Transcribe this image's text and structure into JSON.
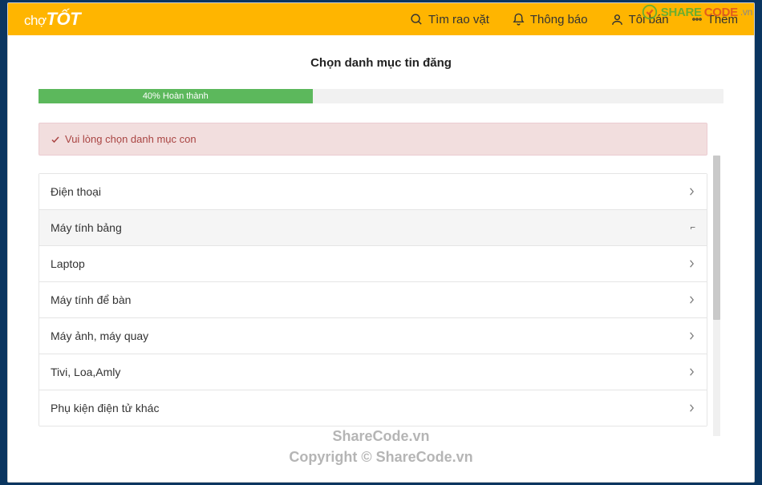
{
  "header": {
    "logo_cho": "chợ",
    "logo_tot": "TỐT",
    "nav": {
      "search": "Tìm rao vặt",
      "notify": "Thông báo",
      "sell": "Tôi bán",
      "more": "Thêm"
    }
  },
  "page": {
    "title": "Chọn danh mục tin đăng",
    "progress_percent": 40,
    "progress_label": "40% Hoàn thành",
    "alert": "Vui lòng chọn danh mục con"
  },
  "categories": [
    {
      "label": "Điện thoại",
      "state": "closed"
    },
    {
      "label": "Máy tính bảng",
      "state": "open"
    },
    {
      "label": "Laptop",
      "state": "closed"
    },
    {
      "label": "Máy tính để bàn",
      "state": "closed"
    },
    {
      "label": "Máy ảnh, máy quay",
      "state": "closed"
    },
    {
      "label": "Tivi, Loa,Amly",
      "state": "closed"
    },
    {
      "label": "Phụ kiện điện tử khác",
      "state": "closed"
    }
  ],
  "watermark": {
    "badge_share": "SHARE",
    "badge_code": "CODE",
    "badge_vn": ".vn",
    "line1": "ShareCode.vn",
    "line2": "Copyright © ShareCode.vn"
  }
}
